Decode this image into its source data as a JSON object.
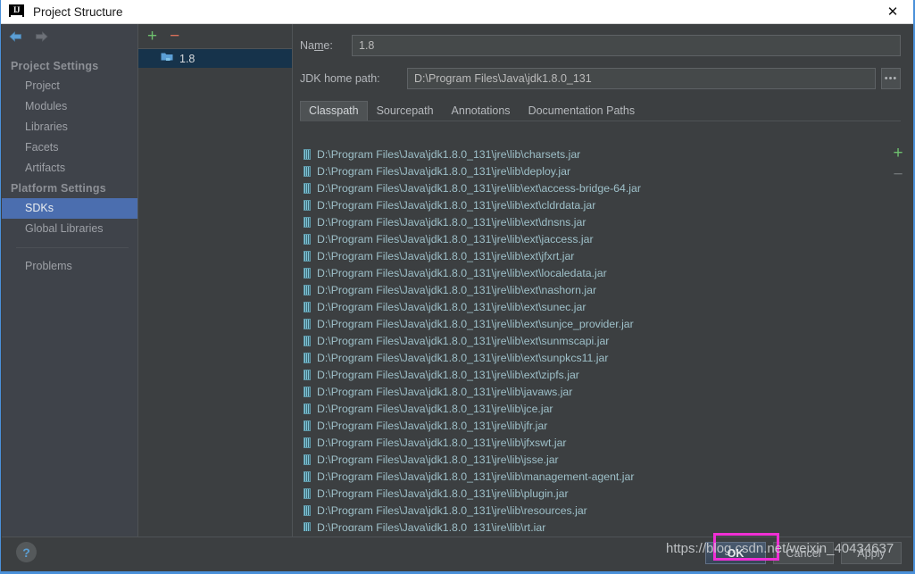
{
  "window": {
    "title": "Project Structure",
    "app_icon": "intellij-idea-icon",
    "close_label": "✕"
  },
  "nav": {
    "back_icon": "arrow-left-icon",
    "forward_icon": "arrow-right-icon"
  },
  "sidebar": {
    "groups": [
      {
        "label": "Project Settings",
        "items": [
          {
            "label": "Project",
            "selected": false
          },
          {
            "label": "Modules",
            "selected": false
          },
          {
            "label": "Libraries",
            "selected": false
          },
          {
            "label": "Facets",
            "selected": false
          },
          {
            "label": "Artifacts",
            "selected": false
          }
        ]
      },
      {
        "label": "Platform Settings",
        "items": [
          {
            "label": "SDKs",
            "selected": true
          },
          {
            "label": "Global Libraries",
            "selected": false
          }
        ]
      }
    ],
    "footer_items": [
      {
        "label": "Problems",
        "selected": false
      }
    ]
  },
  "sdk_panel": {
    "add_label": "+",
    "remove_label": "−",
    "items": [
      {
        "label": "1.8",
        "icon": "jdk-folder-icon",
        "selected": true
      }
    ]
  },
  "form": {
    "name_label_pre": "Na",
    "name_label_mid": "m",
    "name_label_post": "e:",
    "name_value": "1.8",
    "name_placeholder": "",
    "jdk_label": "JDK home path:",
    "jdk_value": "D:\\Program Files\\Java\\jdk1.8.0_131",
    "jdk_placeholder": "",
    "browse_label": "•••"
  },
  "tabs": [
    {
      "label": "Classpath",
      "active": true
    },
    {
      "label": "Sourcepath",
      "active": false
    },
    {
      "label": "Annotations",
      "active": false
    },
    {
      "label": "Documentation Paths",
      "active": false
    }
  ],
  "classpath": {
    "add_label": "+",
    "remove_label": "−",
    "entries": [
      "D:\\Program Files\\Java\\jdk1.8.0_131\\jre\\lib\\charsets.jar",
      "D:\\Program Files\\Java\\jdk1.8.0_131\\jre\\lib\\deploy.jar",
      "D:\\Program Files\\Java\\jdk1.8.0_131\\jre\\lib\\ext\\access-bridge-64.jar",
      "D:\\Program Files\\Java\\jdk1.8.0_131\\jre\\lib\\ext\\cldrdata.jar",
      "D:\\Program Files\\Java\\jdk1.8.0_131\\jre\\lib\\ext\\dnsns.jar",
      "D:\\Program Files\\Java\\jdk1.8.0_131\\jre\\lib\\ext\\jaccess.jar",
      "D:\\Program Files\\Java\\jdk1.8.0_131\\jre\\lib\\ext\\jfxrt.jar",
      "D:\\Program Files\\Java\\jdk1.8.0_131\\jre\\lib\\ext\\localedata.jar",
      "D:\\Program Files\\Java\\jdk1.8.0_131\\jre\\lib\\ext\\nashorn.jar",
      "D:\\Program Files\\Java\\jdk1.8.0_131\\jre\\lib\\ext\\sunec.jar",
      "D:\\Program Files\\Java\\jdk1.8.0_131\\jre\\lib\\ext\\sunjce_provider.jar",
      "D:\\Program Files\\Java\\jdk1.8.0_131\\jre\\lib\\ext\\sunmscapi.jar",
      "D:\\Program Files\\Java\\jdk1.8.0_131\\jre\\lib\\ext\\sunpkcs11.jar",
      "D:\\Program Files\\Java\\jdk1.8.0_131\\jre\\lib\\ext\\zipfs.jar",
      "D:\\Program Files\\Java\\jdk1.8.0_131\\jre\\lib\\javaws.jar",
      "D:\\Program Files\\Java\\jdk1.8.0_131\\jre\\lib\\jce.jar",
      "D:\\Program Files\\Java\\jdk1.8.0_131\\jre\\lib\\jfr.jar",
      "D:\\Program Files\\Java\\jdk1.8.0_131\\jre\\lib\\jfxswt.jar",
      "D:\\Program Files\\Java\\jdk1.8.0_131\\jre\\lib\\jsse.jar",
      "D:\\Program Files\\Java\\jdk1.8.0_131\\jre\\lib\\management-agent.jar",
      "D:\\Program Files\\Java\\jdk1.8.0_131\\jre\\lib\\plugin.jar",
      "D:\\Program Files\\Java\\jdk1.8.0_131\\jre\\lib\\resources.jar",
      "D:\\Program Files\\Java\\jdk1.8.0_131\\jre\\lib\\rt.jar"
    ]
  },
  "footer": {
    "help_label": "?",
    "ok_label": "OK",
    "cancel_label": "Cancel",
    "apply_label": "Apply"
  },
  "overlay": {
    "watermark": "https://blog.csdn.net/weixin_40434637",
    "highlight_color": "#ef2fd4"
  }
}
